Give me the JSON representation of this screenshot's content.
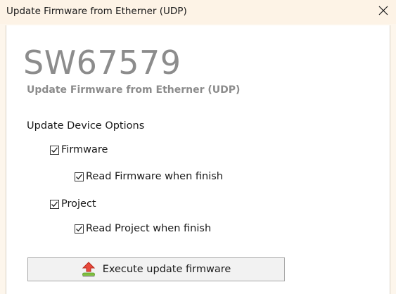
{
  "window": {
    "title": "Update Firmware from Etherner (UDP)",
    "close_icon": "close-icon"
  },
  "header": {
    "code": "SW67579",
    "subtitle": "Update Firmware from Etherner (UDP)"
  },
  "options": {
    "section_label": "Update Device Options",
    "items": [
      {
        "label": "Firmware",
        "checked": true
      },
      {
        "label": "Read Firmware when finish",
        "checked": true
      },
      {
        "label": "Project",
        "checked": true
      },
      {
        "label": "Read Project when finish",
        "checked": true
      }
    ]
  },
  "actions": {
    "execute_label": "Execute update firmware",
    "execute_icon": "upload-arrow-icon"
  },
  "colors": {
    "title_gray": "#8c8c8c",
    "arrow_red": "#d9362b",
    "bar_green": "#7fbf3f"
  }
}
